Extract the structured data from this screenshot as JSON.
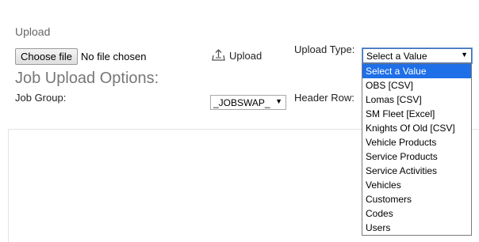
{
  "upload_section": {
    "title": "Upload",
    "choose_file_label": "Choose file",
    "file_status": "No file chosen",
    "upload_label": "Upload"
  },
  "options_section": {
    "title": "Job Upload Options:",
    "job_group_label": "Job Group:",
    "job_group_value": "_JOBSWAP_",
    "upload_type_label": "Upload Type:",
    "header_row_label": "Header Row:"
  },
  "upload_type_select": {
    "value": "Select a Value",
    "options": [
      "Select a Value",
      "OBS [CSV]",
      "Lomas [CSV]",
      "SM Fleet [Excel]",
      "Knights Of Old [CSV]",
      "Vehicle Products",
      "Service Products",
      "Service Activities",
      "Vehicles",
      "Customers",
      "Codes",
      "Users"
    ],
    "selected_index": 0
  },
  "colors": {
    "highlight": "#1e6fe8",
    "focus_border": "#3c6fb7"
  },
  "icons": {
    "upload": "upload-tray-icon",
    "dropdown_arrow": "triangle-down-icon"
  }
}
